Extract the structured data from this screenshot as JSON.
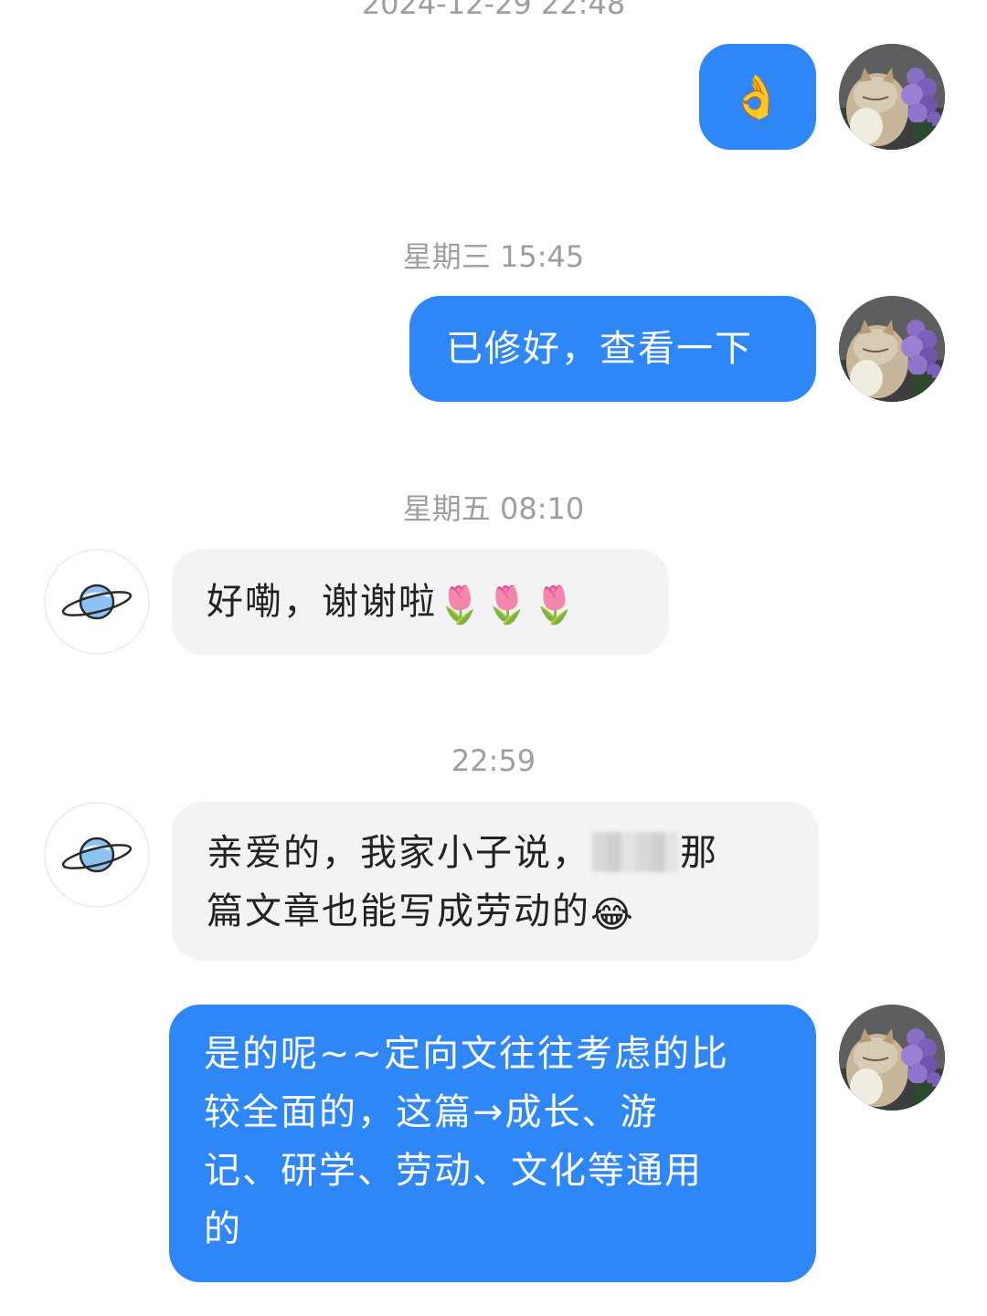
{
  "timestamps": {
    "t0": "2024-12-29 22:48",
    "t1": "星期三 15:45",
    "t2": "星期五 08:10",
    "t3": "22:59"
  },
  "messages": {
    "m1": {
      "emoji": "👌"
    },
    "m2": {
      "text": "已修好，查看一下"
    },
    "m3": {
      "text": "好嘞，谢谢啦",
      "emoji": "🌷🌷🌷"
    },
    "m4": {
      "text_a": "亲爱的，我家小子说，",
      "text_b": "那",
      "text_c": "篇文章也能写成劳动的",
      "emoji": "😂"
    },
    "m5": {
      "line1": "是的呢~~定向文往往考虑的比",
      "line2": "较全面的，这篇→成长、游",
      "line3": "记、研学、劳动、文化等通用",
      "line4": "的"
    }
  },
  "colors": {
    "outgoing_bubble": "#2f86f6",
    "incoming_bubble": "#f3f3f5",
    "timestamp": "#9e9e9e"
  },
  "icons": {
    "my_avatar": "cat-with-purple-flowers-photo",
    "their_avatar": "saturn-planet-icon"
  }
}
